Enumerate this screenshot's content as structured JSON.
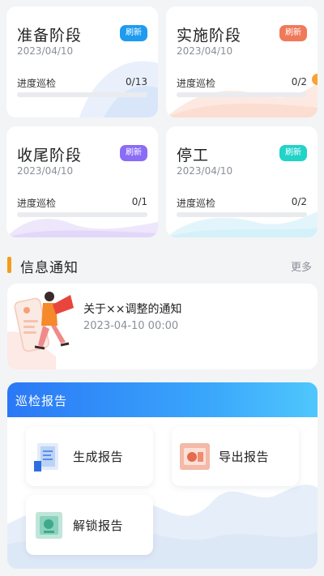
{
  "stages": [
    {
      "title": "准备阶段",
      "date": "2023/04/10",
      "refresh_label": "刷新",
      "refresh_color": "#1e9bf0",
      "progress_label": "进度巡检",
      "done": 0,
      "total": 13,
      "count_text": "0/13",
      "progress_fraction": 0
    },
    {
      "title": "实施阶段",
      "date": "2023/04/10",
      "refresh_label": "刷新",
      "refresh_color": "#f0795a",
      "progress_label": "进度巡检",
      "done": 0,
      "total": 2,
      "count_text": "0/2",
      "progress_fraction": 0
    },
    {
      "title": "收尾阶段",
      "date": "2023/04/10",
      "refresh_label": "刷新",
      "refresh_color": "#8b6cf6",
      "progress_label": "进度巡检",
      "done": 0,
      "total": 1,
      "count_text": "0/1",
      "progress_fraction": 0
    },
    {
      "title": "停工",
      "date": "2023/04/10",
      "refresh_label": "刷新",
      "refresh_color": "#22d3c8",
      "progress_label": "进度巡检",
      "done": 0,
      "total": 2,
      "count_text": "0/2",
      "progress_fraction": 0
    }
  ],
  "notice": {
    "section_title": "信息通知",
    "more_label": "更多",
    "items": [
      {
        "title": "关于××调整的通知",
        "time": "2023-04-10 00:00",
        "icon": "reading-person-illustration"
      }
    ]
  },
  "report": {
    "title": "巡检报告",
    "buttons": [
      {
        "label": "生成报告",
        "icon": "generate-report-icon"
      },
      {
        "label": "导出报告",
        "icon": "export-report-icon"
      },
      {
        "label": "解锁报告",
        "icon": "unlock-report-icon"
      }
    ]
  },
  "colors": {
    "accent_orange": "#f39b1c",
    "report_header_blue": "#2a78f6",
    "background": "#f3f4f6"
  }
}
